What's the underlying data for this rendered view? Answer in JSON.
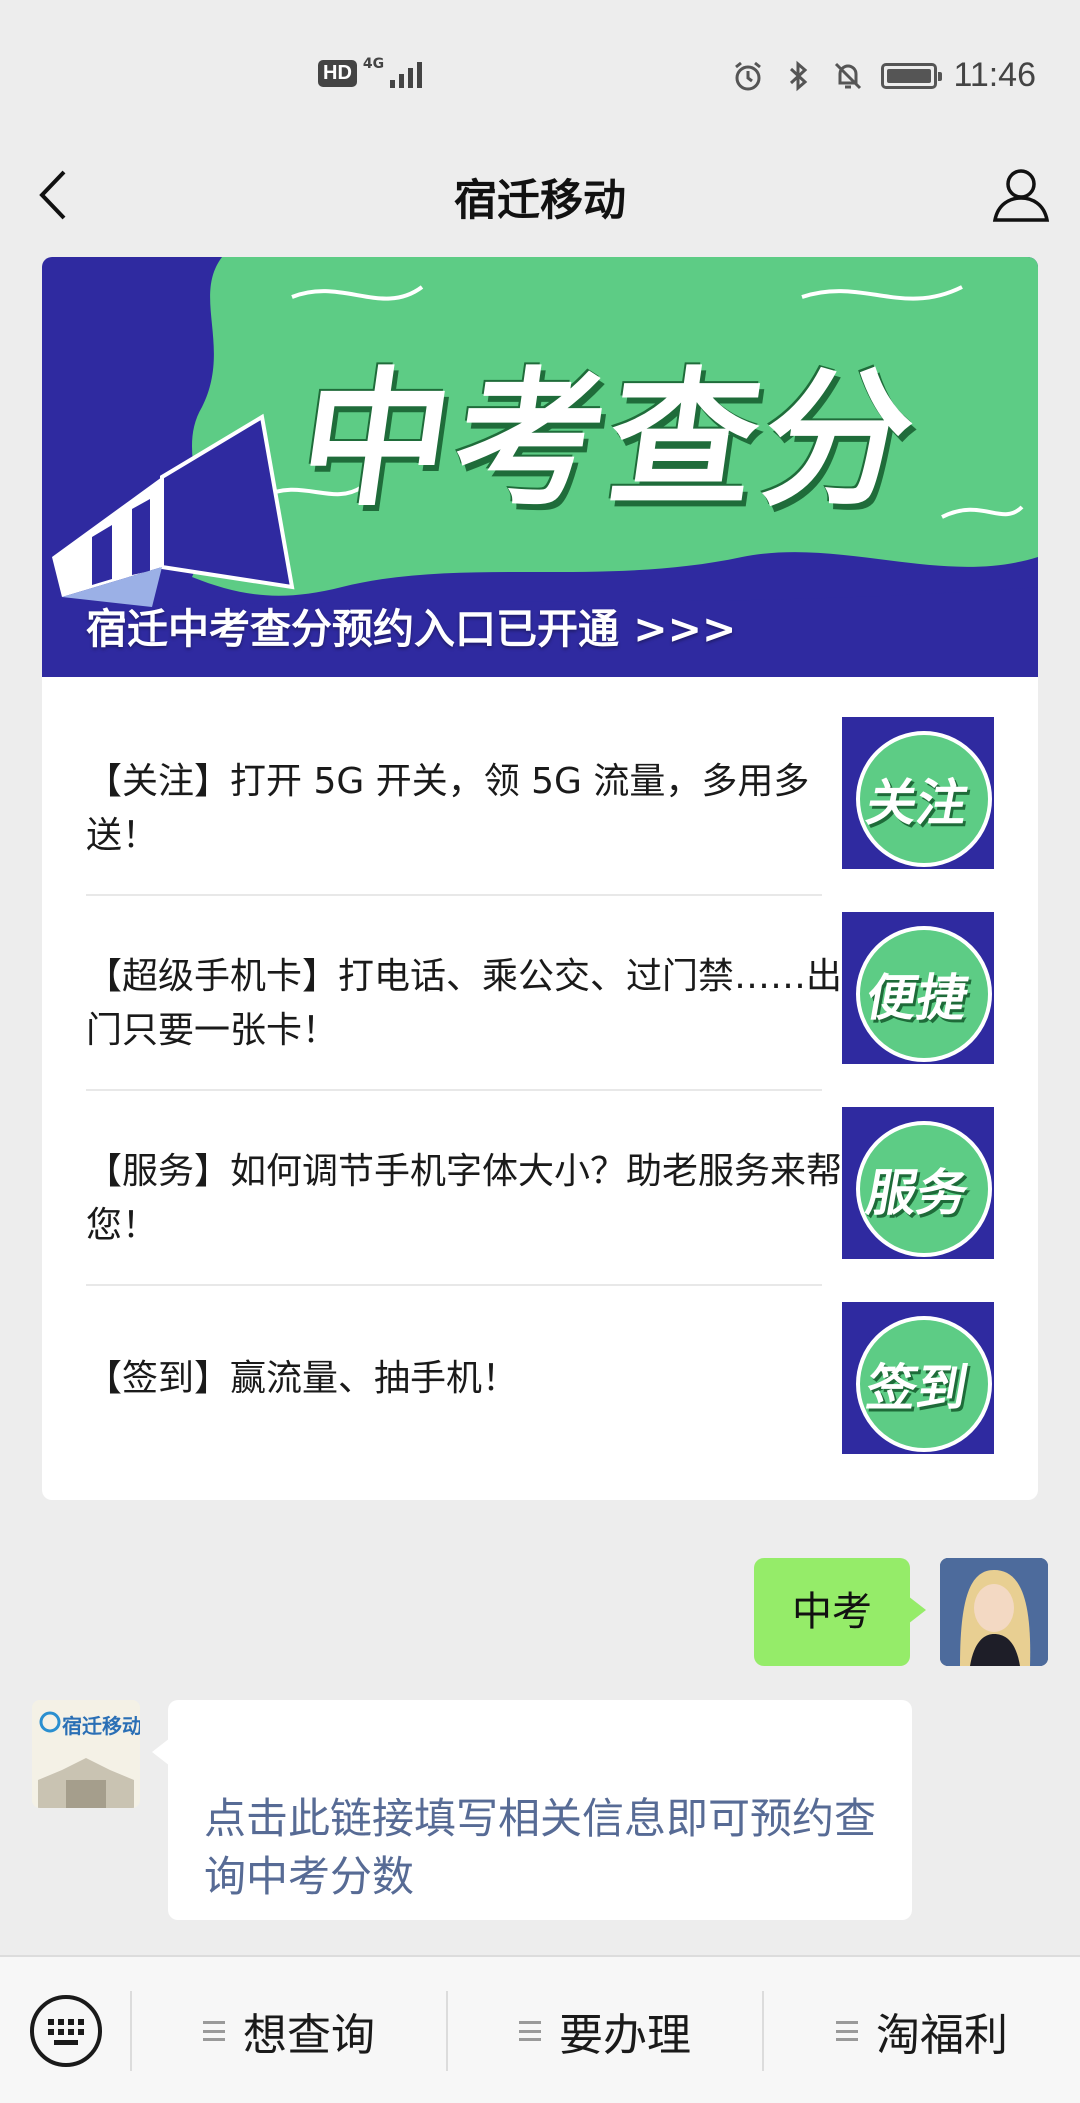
{
  "status_bar": {
    "hd": "HD",
    "network": "4G",
    "time": "11:46",
    "icons": [
      "alarm-icon",
      "bluetooth-icon",
      "mute-icon",
      "battery-icon"
    ]
  },
  "nav": {
    "title": "宿迁移动",
    "back_icon": "chevron-left-icon",
    "profile_icon": "user-profile-icon"
  },
  "article": {
    "banner_title": "中考查分",
    "banner_caption": "宿迁中考查分预约入口已开通 >>>",
    "items": [
      {
        "text": "【关注】打开 5G 开关，领 5G 流量，多用多送！",
        "thumb_label": "关注"
      },
      {
        "text": "【超级手机卡】打电话、乘公交、过门禁……出门只要一张卡！",
        "thumb_label": "便捷"
      },
      {
        "text": "【服务】如何调节手机字体大小？助老服务来帮您！",
        "thumb_label": "服务"
      },
      {
        "text": "【签到】赢流量、抽手机！",
        "thumb_label": "签到"
      }
    ]
  },
  "chat": {
    "outgoing": "中考",
    "incoming_link": "点击此链接填写相关信息即可预约查询中考分数",
    "bot_avatar_text": "宿迁移动"
  },
  "menu": {
    "keyboard_icon": "keyboard-icon",
    "items": [
      "想查询",
      "要办理",
      "淘福利"
    ]
  },
  "colors": {
    "banner_blue": "#2f2aa0",
    "banner_green": "#5dcc85",
    "bubble_green": "#95ec69",
    "link_blue": "#576b95",
    "background": "#ededed"
  }
}
